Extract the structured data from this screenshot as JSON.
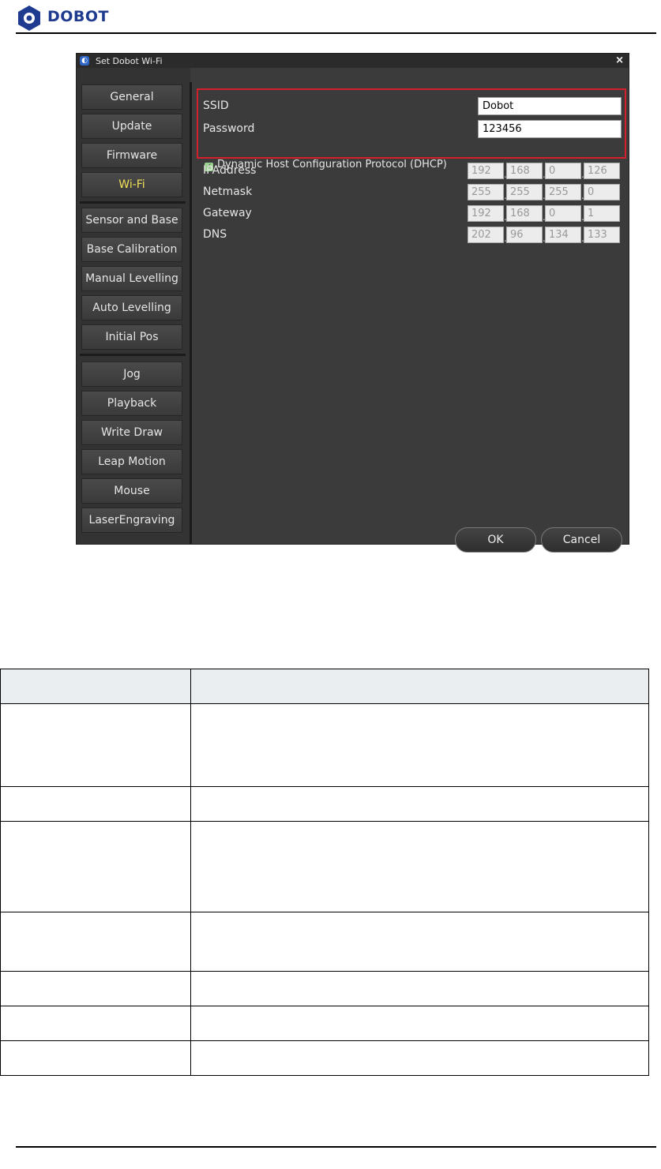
{
  "header": {
    "brand": "DOBOT"
  },
  "dialog": {
    "title": "Set Dobot Wi-Fi",
    "close": "×",
    "nav_group1": [
      "General",
      "Update",
      "Firmware",
      "Wi-Fi"
    ],
    "nav_group2": [
      "Sensor and Base",
      "Base Calibration",
      "Manual Levelling",
      "Auto Levelling",
      "Initial Pos"
    ],
    "nav_group3": [
      "Jog",
      "Playback",
      "Write  Draw",
      "Leap Motion",
      "Mouse",
      "LaserEngraving"
    ],
    "active_item": "Wi-Fi",
    "ssid_label": "SSID",
    "ssid_value": "Dobot",
    "password_label": "Password",
    "password_value": "123456",
    "dhcp_label": "Dynamic Host Configuration Protocol (DHCP)",
    "dhcp_checked": true,
    "ip_label": "IPAddress",
    "ip_value": [
      "192",
      "168",
      "0",
      "126"
    ],
    "netmask_label": "Netmask",
    "netmask_value": [
      "255",
      "255",
      "255",
      "0"
    ],
    "gateway_label": "Gateway",
    "gateway_value": [
      "192",
      "168",
      "0",
      "1"
    ],
    "dns_label": "DNS",
    "dns_value": [
      "202",
      "96",
      "134",
      "133"
    ],
    "ok_label": "OK",
    "cancel_label": "Cancel"
  },
  "table": {
    "rows": 7
  }
}
